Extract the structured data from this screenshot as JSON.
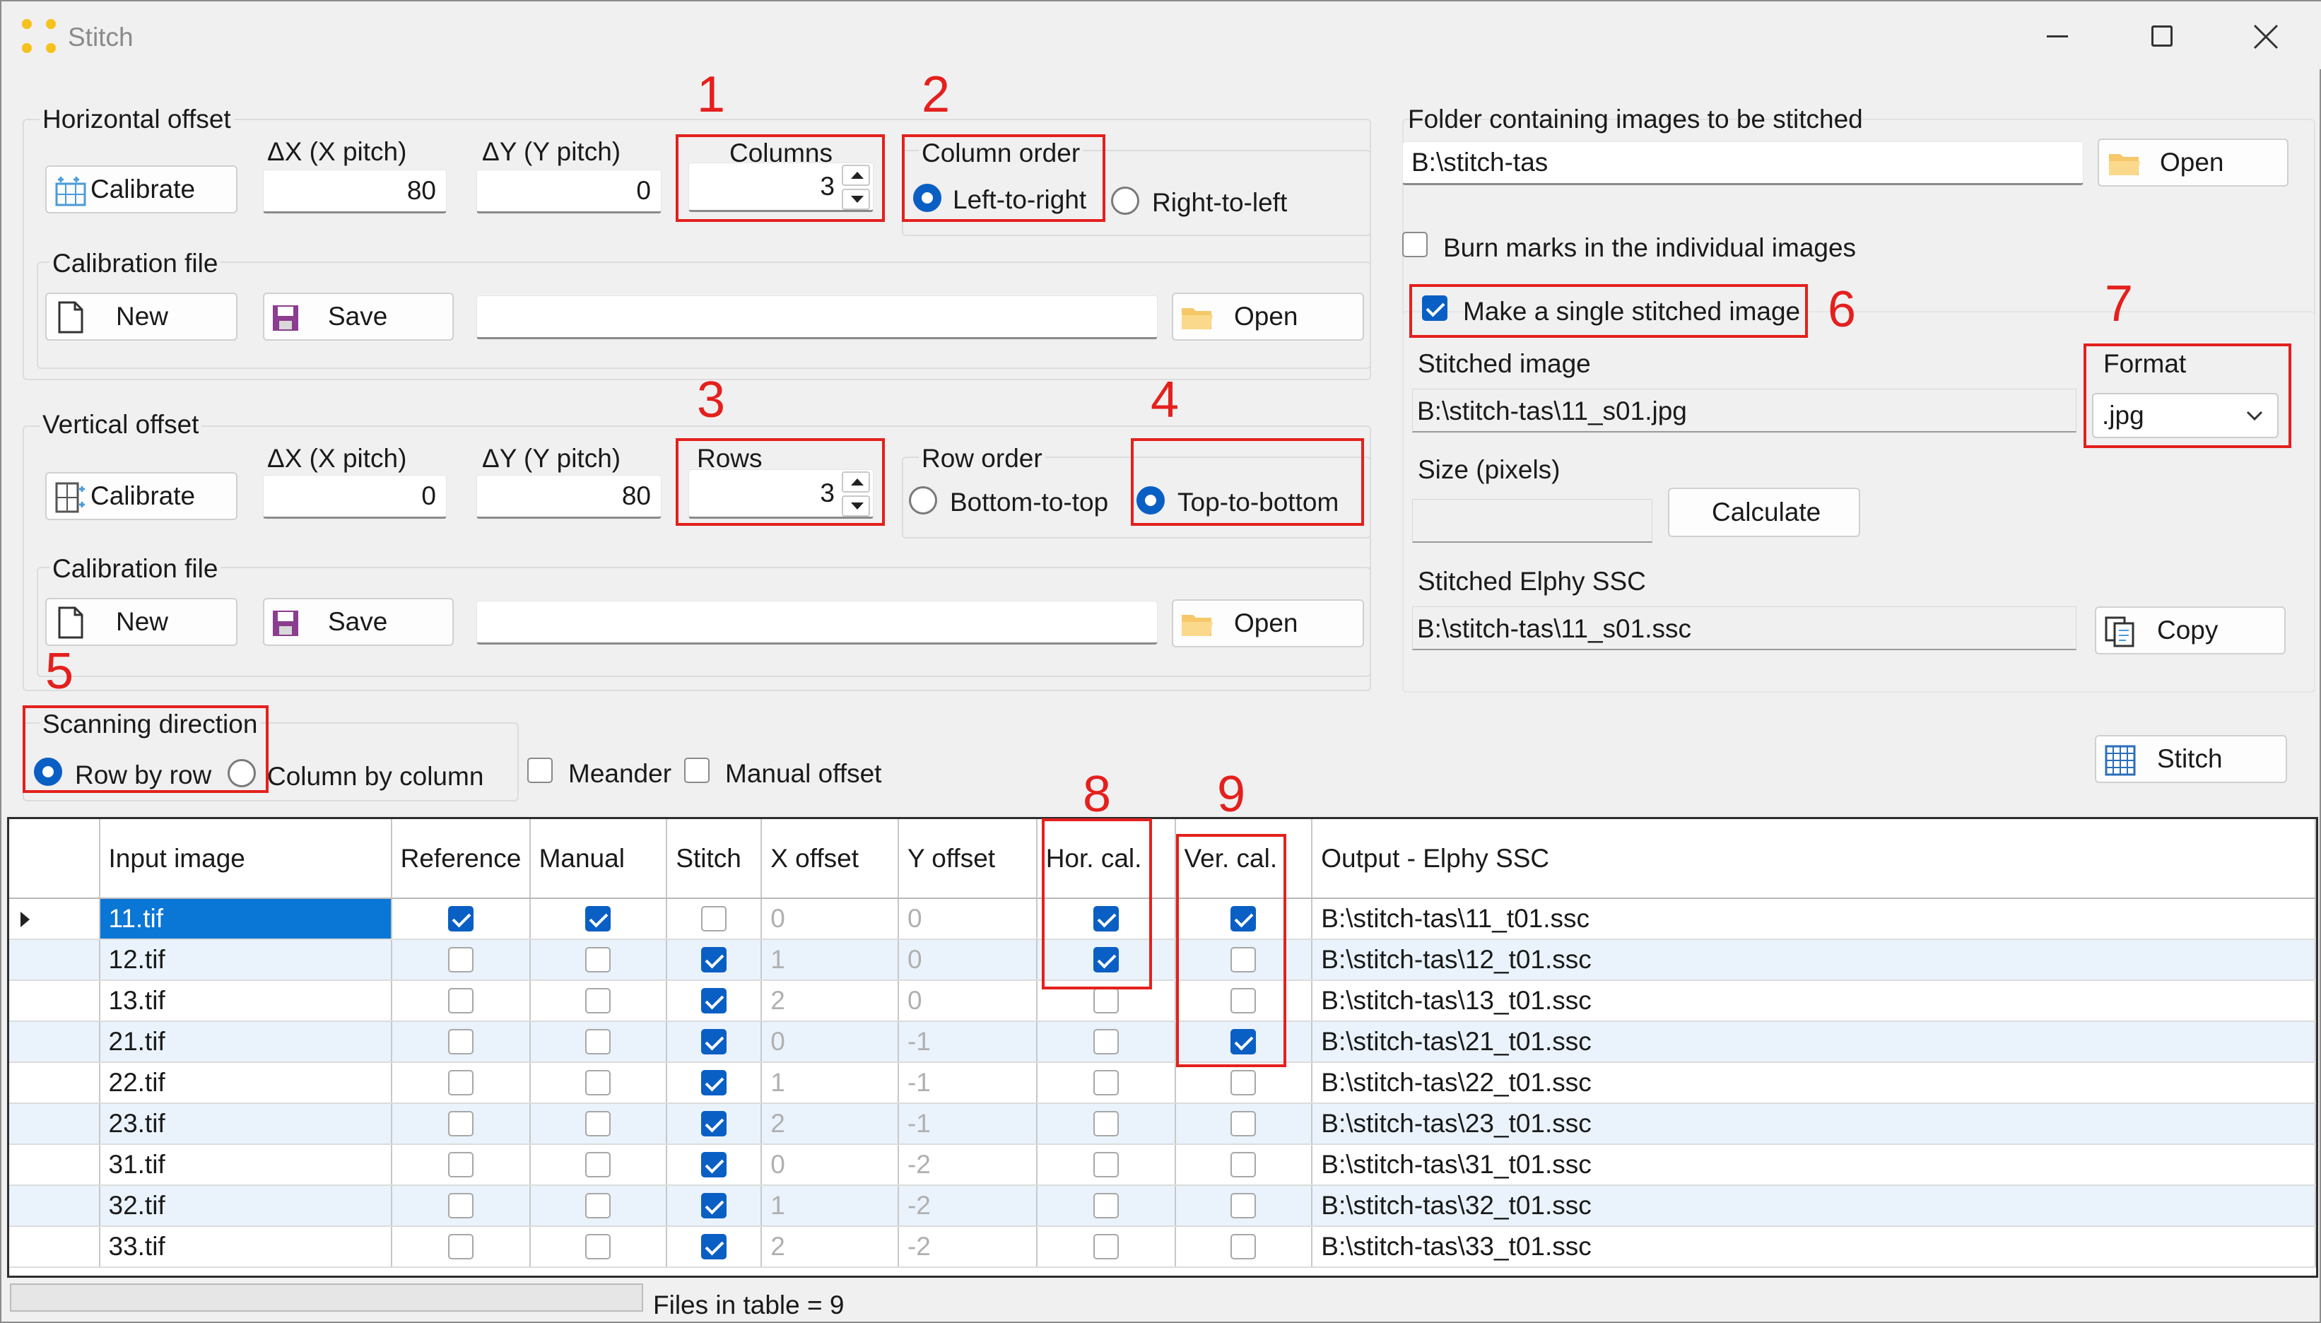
{
  "window": {
    "title": "Stitch"
  },
  "horizontal": {
    "group_label": "Horizontal offset",
    "calibrate": "Calibrate",
    "dx_label": "ΔX (X pitch)",
    "dx_value": "80",
    "dy_label": "ΔY (Y pitch)",
    "dy_value": "0",
    "columns_label": "Columns",
    "columns_value": "3",
    "order_label": "Column order",
    "order_left": "Left-to-right",
    "order_right": "Right-to-left",
    "calib_file_label": "Calibration file",
    "new": "New",
    "save": "Save",
    "open": "Open",
    "file_value": ""
  },
  "vertical": {
    "group_label": "Vertical offset",
    "calibrate": "Calibrate",
    "dx_label": "ΔX (X pitch)",
    "dx_value": "0",
    "dy_label": "ΔY (Y pitch)",
    "dy_value": "80",
    "rows_label": "Rows",
    "rows_value": "3",
    "order_label": "Row order",
    "order_bottom": "Bottom-to-top",
    "order_top": "Top-to-bottom",
    "calib_file_label": "Calibration file",
    "new": "New",
    "save": "Save",
    "open": "Open",
    "file_value": ""
  },
  "scanning": {
    "label": "Scanning direction",
    "row": "Row by row",
    "column": "Column by column",
    "meander": "Meander",
    "manual_offset": "Manual offset"
  },
  "right": {
    "folder_label": "Folder containing images to be stitched",
    "folder_value": "B:\\stitch-tas",
    "open": "Open",
    "burn_marks": "Burn marks in the individual images",
    "single_image": "Make a single stitched image",
    "stitched_label": "Stitched image",
    "stitched_value": "B:\\stitch-tas\\11_s01.jpg",
    "format_label": "Format",
    "format_value": ".jpg",
    "size_label": "Size (pixels)",
    "calculate": "Calculate",
    "ssc_label": "Stitched Elphy SSC",
    "ssc_value": "B:\\stitch-tas\\11_s01.ssc",
    "copy": "Copy",
    "stitch": "Stitch"
  },
  "annotations": [
    "1",
    "2",
    "3",
    "4",
    "5",
    "6",
    "7",
    "8",
    "9"
  ],
  "table": {
    "headers": [
      "Input image",
      "Reference",
      "Manual",
      "Stitch",
      "X offset",
      "Y offset",
      "Hor. cal.",
      "Ver. cal.",
      "Output - Elphy SSC"
    ],
    "rows": [
      {
        "image": "11.tif",
        "x": "0",
        "y": "0",
        "out": "B:\\stitch-tas\\11_t01.ssc"
      },
      {
        "image": "12.tif",
        "x": "1",
        "y": "0",
        "out": "B:\\stitch-tas\\12_t01.ssc"
      },
      {
        "image": "13.tif",
        "x": "2",
        "y": "0",
        "out": "B:\\stitch-tas\\13_t01.ssc"
      },
      {
        "image": "21.tif",
        "x": "0",
        "y": "-1",
        "out": "B:\\stitch-tas\\21_t01.ssc"
      },
      {
        "image": "22.tif",
        "x": "1",
        "y": "-1",
        "out": "B:\\stitch-tas\\22_t01.ssc"
      },
      {
        "image": "23.tif",
        "x": "2",
        "y": "-1",
        "out": "B:\\stitch-tas\\23_t01.ssc"
      },
      {
        "image": "31.tif",
        "x": "0",
        "y": "-2",
        "out": "B:\\stitch-tas\\31_t01.ssc"
      },
      {
        "image": "32.tif",
        "x": "1",
        "y": "-2",
        "out": "B:\\stitch-tas\\32_t01.ssc"
      },
      {
        "image": "33.tif",
        "x": "2",
        "y": "-2",
        "out": "B:\\stitch-tas\\33_t01.ssc"
      }
    ]
  },
  "status": {
    "files": "Files in table = 9"
  },
  "colors": {
    "accent": "#0a5fc4",
    "selected_row": "#0a76d6",
    "annotation_red": "#e4201d",
    "alt_row": "#eaf3fc"
  }
}
